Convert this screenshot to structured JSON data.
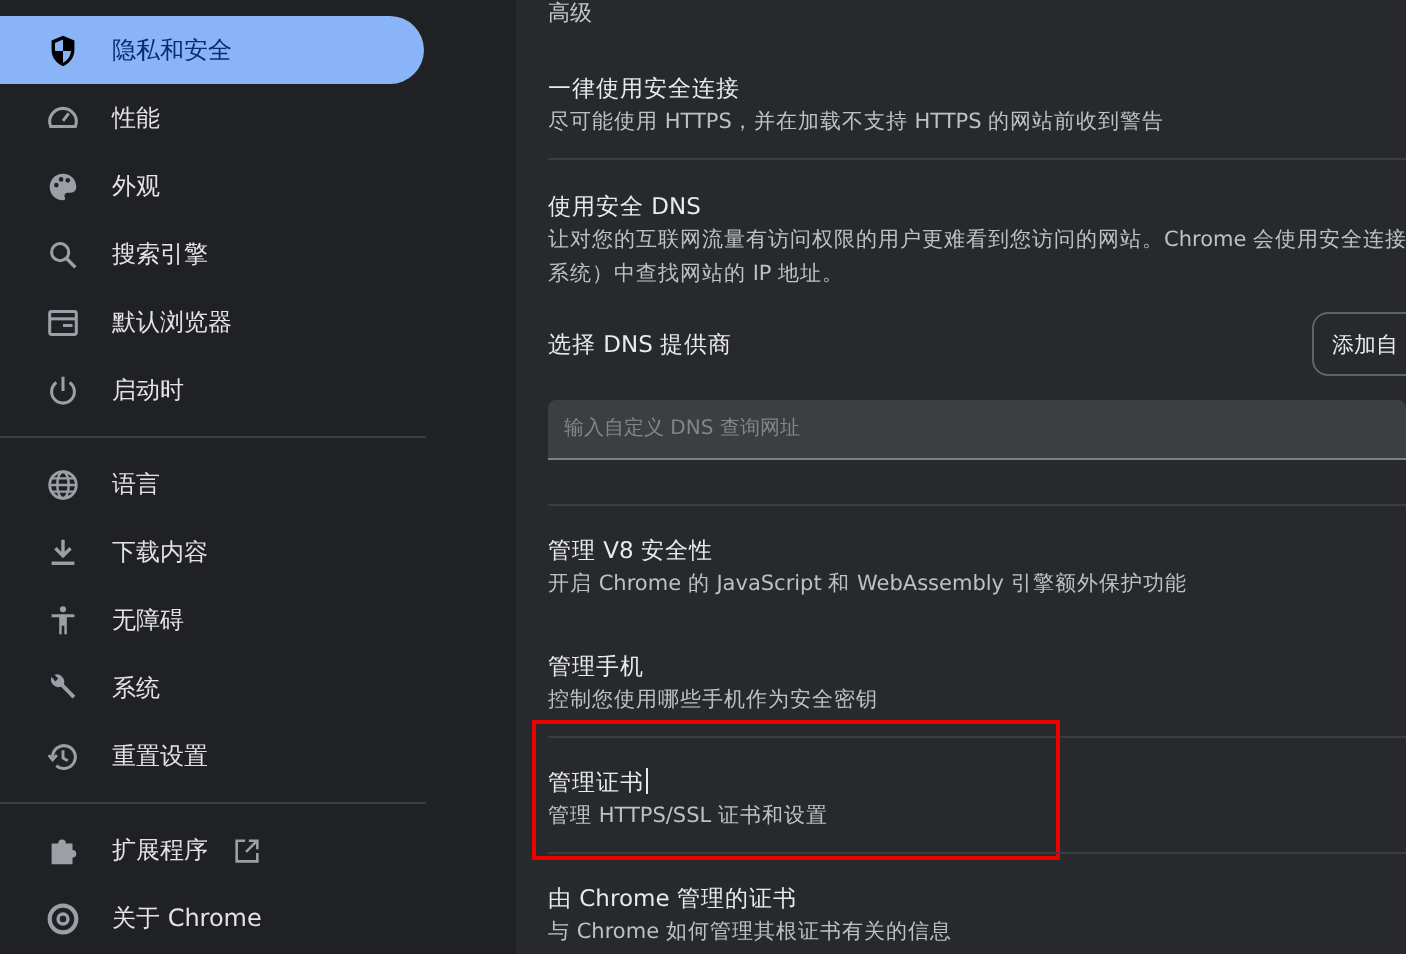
{
  "sidebar": {
    "sections": [
      {
        "items": [
          {
            "label": "隐私和安全",
            "selected": true,
            "external_link": false
          },
          {
            "label": "性能",
            "selected": false,
            "external_link": false
          },
          {
            "label": "外观",
            "selected": false,
            "external_link": false
          },
          {
            "label": "搜索引擎",
            "selected": false,
            "external_link": false
          },
          {
            "label": "默认浏览器",
            "selected": false,
            "external_link": false
          },
          {
            "label": "启动时",
            "selected": false,
            "external_link": false
          }
        ]
      },
      {
        "items": [
          {
            "label": "语言",
            "selected": false,
            "external_link": false
          },
          {
            "label": "下载内容",
            "selected": false,
            "external_link": false
          },
          {
            "label": "无障碍",
            "selected": false,
            "external_link": false
          },
          {
            "label": "系统",
            "selected": false,
            "external_link": false
          },
          {
            "label": "重置设置",
            "selected": false,
            "external_link": false
          }
        ]
      },
      {
        "items": [
          {
            "label": "扩展程序",
            "selected": false,
            "external_link": true
          },
          {
            "label": "关于 Chrome",
            "selected": false,
            "external_link": false
          }
        ]
      }
    ]
  },
  "content": {
    "section_heading": "高级",
    "rows": [
      {
        "kind": "text",
        "title": "一律使用安全连接",
        "description": "尽可能使用 HTTPS，并在加载不支持 HTTPS 的网站前收到警告",
        "separator_above": false,
        "highlighted": false,
        "text_cursor": false
      },
      {
        "kind": "dns",
        "separator_above": true,
        "title": "使用安全 DNS",
        "description_lines": [
          "让对您的互联网流量有访问权限的用户更难看到您访问的网站。Chrome 会使用安全连接",
          "系统）中查找网站的 IP 地址。"
        ],
        "provider_label": "选择 DNS 提供商",
        "provider_button": "添加自",
        "field_placeholder": "输入自定义 DNS 查询网址"
      },
      {
        "kind": "text",
        "title": "管理 V8 安全性",
        "description": "开启 Chrome 的 JavaScript 和 WebAssembly 引擎额外保护功能",
        "separator_above": true,
        "highlighted": false,
        "text_cursor": false
      },
      {
        "kind": "text",
        "title": "管理手机",
        "description": "控制您使用哪些手机作为安全密钥",
        "separator_above": false,
        "highlighted": false,
        "text_cursor": false
      },
      {
        "kind": "text",
        "title": "管理证书",
        "description": "管理 HTTPS/SSL 证书和设置",
        "separator_above": true,
        "highlighted": true,
        "text_cursor": true
      },
      {
        "kind": "text",
        "title": "由 Chrome 管理的证书",
        "description": "与 Chrome 如何管理其根证书有关的信息",
        "separator_above": true,
        "highlighted": false,
        "text_cursor": false
      }
    ]
  }
}
